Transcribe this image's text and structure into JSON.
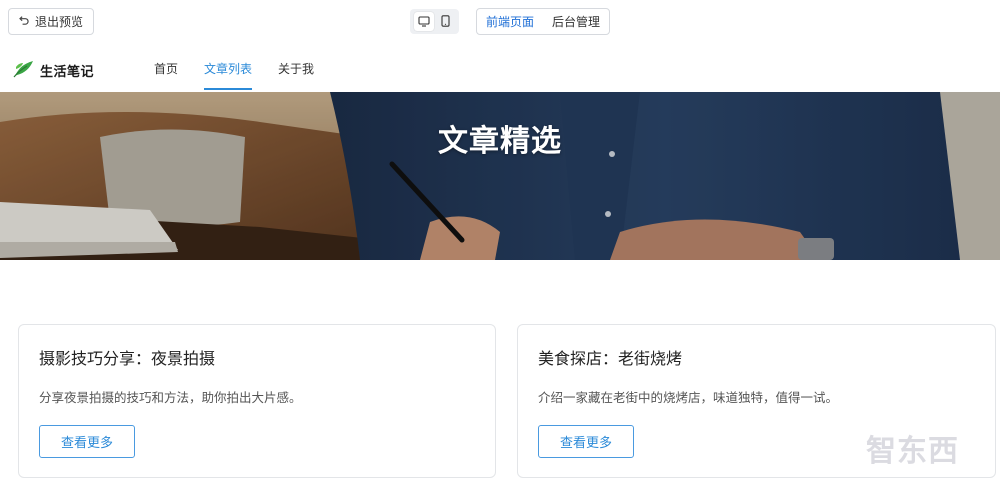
{
  "toolbar": {
    "exit_label": "退出预览",
    "exit_icon": "undo-arrow-icon",
    "devices": [
      "desktop-icon",
      "mobile-icon"
    ],
    "modes": [
      "前端页面",
      "后台管理"
    ]
  },
  "site": {
    "logo_text": "生活笔记",
    "nav": [
      "首页",
      "文章列表",
      "关于我"
    ],
    "active_nav": "文章列表"
  },
  "hero": {
    "title": "文章精选"
  },
  "articles": [
    {
      "title": "摄影技巧分享：夜景拍摄",
      "summary": "分享夜景拍摄的技巧和方法，助你拍出大片感。",
      "button": "查看更多"
    },
    {
      "title": "美食探店：老街烧烤",
      "summary": "介绍一家藏在老街中的烧烤店，味道独特，值得一试。",
      "button": "查看更多"
    }
  ],
  "watermark": "智东西",
  "colors": {
    "accent": "#2b8ad8",
    "logo_green": "#3aa545",
    "border": "#e3e5e8"
  }
}
